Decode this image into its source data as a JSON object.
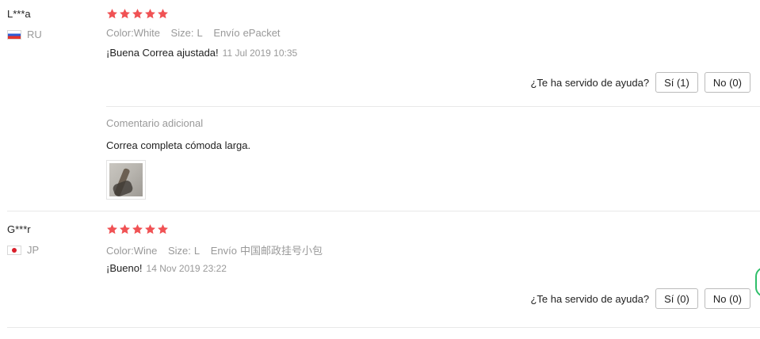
{
  "reviews": [
    {
      "buyer": "L***a",
      "country": "RU",
      "flag": "russia-flag-icon",
      "stars": 5,
      "star_color": "#f05254",
      "color_label": "Color:",
      "color_value": "White",
      "size_label": "Size:",
      "size_value": "L",
      "shipping_label": "Envío",
      "shipping_value": "ePacket",
      "text": "¡Buena Correa ajustada!",
      "date": "11 Jul 2019 10:35",
      "helpful_question": "¿Te ha servido de ayuda?",
      "yes_label": "Sí (1)",
      "no_label": "No (0)",
      "additional": {
        "label": "Comentario adicional",
        "text": "Correa completa cómoda larga.",
        "images": [
          "strap-photo-thumbnail"
        ]
      }
    },
    {
      "buyer": "G***r",
      "country": "JP",
      "flag": "japan-flag-icon",
      "stars": 5,
      "star_color": "#f05254",
      "color_label": "Color:",
      "color_value": "Wine",
      "size_label": "Size:",
      "size_value": "L",
      "shipping_label": "Envío",
      "shipping_value": "中国邮政挂号小包",
      "text": "¡Bueno!",
      "date": "14 Nov 2019 23:22",
      "helpful_question": "¿Te ha servido de ayuda?",
      "yes_label": "Sí (0)",
      "no_label": "No (0)"
    }
  ]
}
